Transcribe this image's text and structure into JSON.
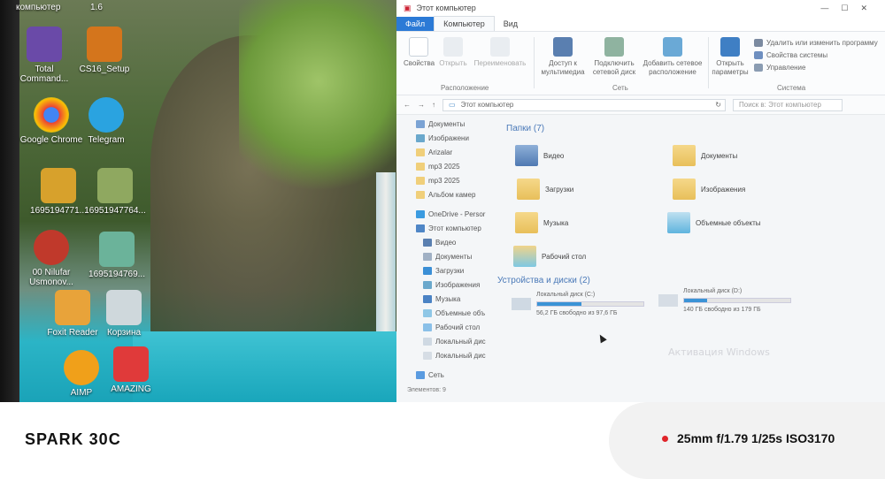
{
  "desktop": {
    "top_labels": [
      "компьютер",
      "1.6"
    ],
    "icons": [
      {
        "label": "Total Command...",
        "color": "#6a4aa8"
      },
      {
        "label": "CS16_Setup",
        "color": "#d4751c"
      },
      {
        "label": "Google Chrome",
        "color": "#4285f4"
      },
      {
        "label": "Telegram",
        "color": "#2aa3e0"
      },
      {
        "label": "1695194771...",
        "color": "#d7a12c"
      },
      {
        "label": "16951947764...",
        "color": "#8fa860"
      },
      {
        "label": "00 Nilufar Usmonov...",
        "color": "#c0392b"
      },
      {
        "label": "1695194769...",
        "color": "#6bb39a"
      },
      {
        "label": "Foxit Reader",
        "color": "#e8a33a"
      },
      {
        "label": "Корзина",
        "color": "#cfd8dc"
      },
      {
        "label": "AIMP",
        "color": "#f0a01a"
      },
      {
        "label": "AMAZING",
        "color": "#e03a3a"
      }
    ]
  },
  "explorer": {
    "title": "Этот компьютер",
    "menu": {
      "file": "Файл",
      "computer": "Компьютер",
      "view": "Вид"
    },
    "ribbon": {
      "properties": "Свойства",
      "open": "Открыть",
      "rename": "Переименовать",
      "location_group": "Расположение",
      "media_access": "Доступ к мультимедиа",
      "map_drive": "Подключить сетевой диск",
      "add_location": "Добавить сетевое расположение",
      "network_group": "Сеть",
      "open_settings": "Открыть параметры",
      "uninstall": "Удалить или изменить программу",
      "system_props": "Свойства системы",
      "manage": "Управление",
      "system_group": "Система"
    },
    "address": "Этот компьютер",
    "search_placeholder": "Поиск в: Этот компьютер",
    "nav": [
      "Документы",
      "Изображени",
      "Arizalar",
      "mp3 2025",
      "mp3 2025",
      "Альбом камер",
      "OneDrive - Persor",
      "Этот компьютер",
      "Видео",
      "Документы",
      "Загрузки",
      "Изображения",
      "Музыка",
      "Объемные объ",
      "Рабочий стол",
      "Локальный дис",
      "Локальный дис",
      "Сеть"
    ],
    "folders_header": "Папки (7)",
    "folders": [
      "Видео",
      "Документы",
      "Загрузки",
      "Изображения",
      "Музыка",
      "Объемные объекты",
      "Рабочий стол"
    ],
    "devices_header": "Устройства и диски (2)",
    "drives": [
      {
        "name": "Локальный диск (C:)",
        "free": "56,2 ГБ свободно из 97,6 ГБ",
        "used_fraction": 0.42
      },
      {
        "name": "Локальный диск (D:)",
        "free": "140 ГБ свободно из 179 ГБ",
        "used_fraction": 0.22
      }
    ],
    "status": "Элементов: 9",
    "watermark": "Активация Windows"
  },
  "footer": {
    "brand": "SPARK 30C",
    "exif": "25mm f/1.79 1/25s ISO3170",
    "accent": "#e0242a"
  }
}
